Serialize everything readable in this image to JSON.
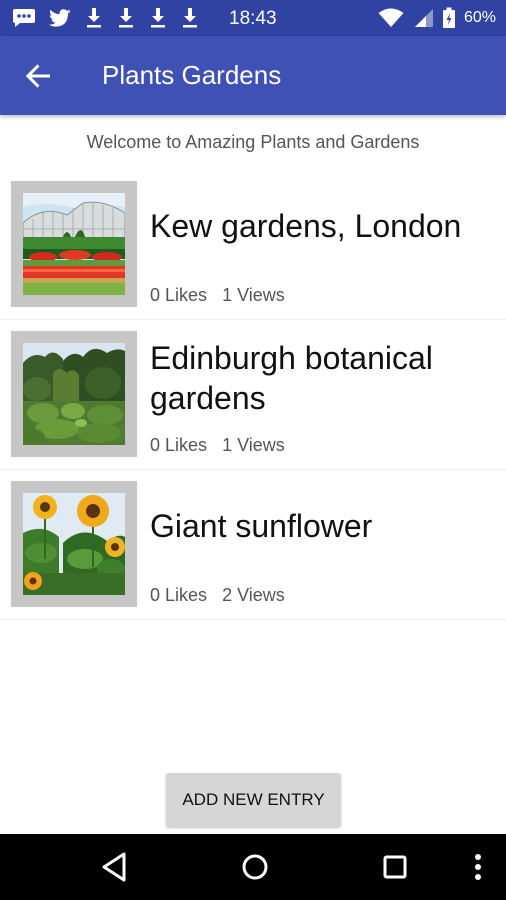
{
  "status_bar": {
    "time": "18:43",
    "battery": "60%",
    "notification_icons": [
      "message-icon",
      "twitter-icon",
      "download-icon",
      "download-icon",
      "download-icon",
      "download-icon"
    ]
  },
  "app_bar": {
    "title": "Plants Gardens",
    "back_icon": "arrow-back-icon",
    "color": "#3f51b5",
    "status_color": "#3043a2"
  },
  "welcome_text": "Welcome to Amazing Plants and Gardens",
  "entries": [
    {
      "title": "Kew gardens, London",
      "likes": "0 Likes",
      "views": "1 Views",
      "image": "glasshouse-garden-photo"
    },
    {
      "title": "Edinburgh botanical gardens",
      "likes": "0 Likes",
      "views": "1 Views",
      "image": "green-garden-photo"
    },
    {
      "title": "Giant sunflower",
      "likes": "0 Likes",
      "views": "2 Views",
      "image": "sunflower-photo"
    }
  ],
  "add_button": {
    "label": "ADD NEW ENTRY"
  },
  "nav_bar": {
    "icons": [
      "back-triangle-icon",
      "home-circle-icon",
      "recents-square-icon",
      "more-vert-icon"
    ]
  }
}
